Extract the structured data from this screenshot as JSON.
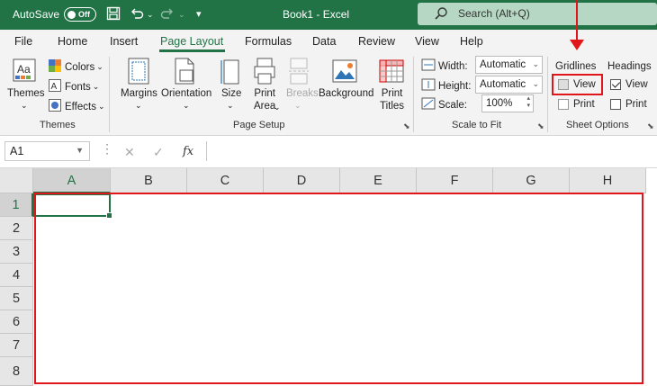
{
  "titlebar": {
    "autosave_label": "AutoSave",
    "autosave_state": "Off",
    "document_title": "Book1  -  Excel",
    "search_placeholder": "Search (Alt+Q)"
  },
  "tabs": [
    "File",
    "Home",
    "Insert",
    "Page Layout",
    "Formulas",
    "Data",
    "Review",
    "View",
    "Help"
  ],
  "ribbon": {
    "themes": {
      "themes_label": "Themes",
      "colors_label": "Colors",
      "fonts_label": "Fonts",
      "effects_label": "Effects",
      "group_label": "Themes"
    },
    "page_setup": {
      "margins": "Margins",
      "orientation": "Orientation",
      "size": "Size",
      "print_area_1": "Print",
      "print_area_2": "Area",
      "breaks": "Breaks",
      "background": "Background",
      "print_titles_1": "Print",
      "print_titles_2": "Titles",
      "group_label": "Page Setup"
    },
    "scale_to_fit": {
      "width_label": "Width:",
      "width_value": "Automatic",
      "height_label": "Height:",
      "height_value": "Automatic",
      "scale_label": "Scale:",
      "scale_value": "100%",
      "group_label": "Scale to Fit"
    },
    "sheet_options": {
      "gridlines_label": "Gridlines",
      "headings_label": "Headings",
      "gridlines_view": "View",
      "gridlines_print": "Print",
      "headings_view": "View",
      "headings_print": "Print",
      "group_label": "Sheet Options"
    }
  },
  "formula_bar": {
    "name_box": "A1",
    "fx": "fx"
  },
  "grid": {
    "columns": [
      "A",
      "B",
      "C",
      "D",
      "E",
      "F",
      "G",
      "H"
    ],
    "rows": [
      "1",
      "2",
      "3",
      "4",
      "5",
      "6",
      "7",
      "8"
    ],
    "selected_cell": "A1"
  },
  "colors": {
    "accent": "#217346",
    "highlight": "#e0161b"
  }
}
